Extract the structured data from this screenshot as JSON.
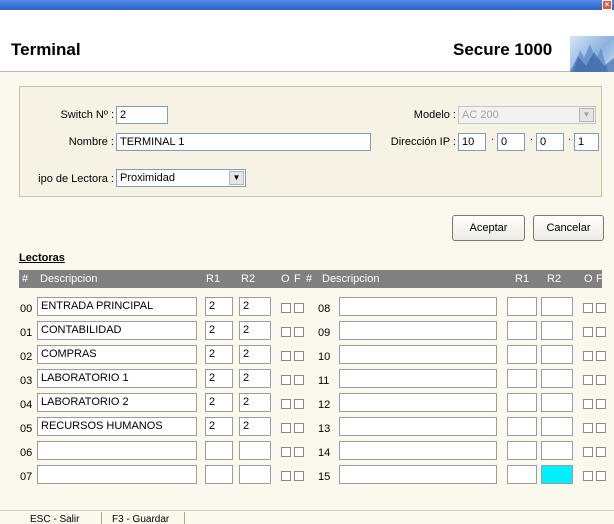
{
  "header": {
    "title": "Terminal",
    "product": "Secure 1000"
  },
  "form": {
    "switch_label": "Switch Nº :",
    "switch_value": "2",
    "nombre_label": "Nombre :",
    "nombre_value": "TERMINAL 1",
    "tipo_label": "ipo de Lectora :",
    "tipo_value": "Proximidad",
    "modelo_label": "Modelo :",
    "modelo_value": "AC 200",
    "ip_label": "Dirección IP :",
    "ip": [
      "10",
      "0",
      "0",
      "1"
    ]
  },
  "buttons": {
    "accept": "Aceptar",
    "cancel": "Cancelar"
  },
  "lectoras": {
    "title": "Lectoras",
    "columns": {
      "num": "#",
      "desc": "Descripcion",
      "r1": "R1",
      "r2": "R2",
      "o": "O",
      "f": "F"
    },
    "right_desc_label": "Descripcion",
    "left": [
      {
        "num": "00",
        "desc": "ENTRADA PRINCIPAL",
        "r1": "2",
        "r2": "2"
      },
      {
        "num": "01",
        "desc": "CONTABILIDAD",
        "r1": "2",
        "r2": "2"
      },
      {
        "num": "02",
        "desc": "COMPRAS",
        "r1": "2",
        "r2": "2"
      },
      {
        "num": "03",
        "desc": "LABORATORIO 1",
        "r1": "2",
        "r2": "2"
      },
      {
        "num": "04",
        "desc": "LABORATORIO 2",
        "r1": "2",
        "r2": "2"
      },
      {
        "num": "05",
        "desc": "RECURSOS HUMANOS",
        "r1": "2",
        "r2": "2"
      },
      {
        "num": "06",
        "desc": "",
        "r1": "",
        "r2": ""
      },
      {
        "num": "07",
        "desc": "",
        "r1": "",
        "r2": ""
      }
    ],
    "right": [
      {
        "num": "08",
        "desc": "",
        "r1": "",
        "r2": ""
      },
      {
        "num": "09",
        "desc": "",
        "r1": "",
        "r2": ""
      },
      {
        "num": "10",
        "desc": "",
        "r1": "",
        "r2": ""
      },
      {
        "num": "11",
        "desc": "",
        "r1": "",
        "r2": ""
      },
      {
        "num": "12",
        "desc": "",
        "r1": "",
        "r2": ""
      },
      {
        "num": "13",
        "desc": "",
        "r1": "",
        "r2": ""
      },
      {
        "num": "14",
        "desc": "",
        "r1": "",
        "r2": ""
      },
      {
        "num": "15",
        "desc": "",
        "r1": "",
        "r2": ""
      }
    ],
    "highlight_color": "#00f0ff"
  },
  "statusbar": {
    "esc": "ESC - Salir",
    "f3": "F3 - Guardar"
  }
}
